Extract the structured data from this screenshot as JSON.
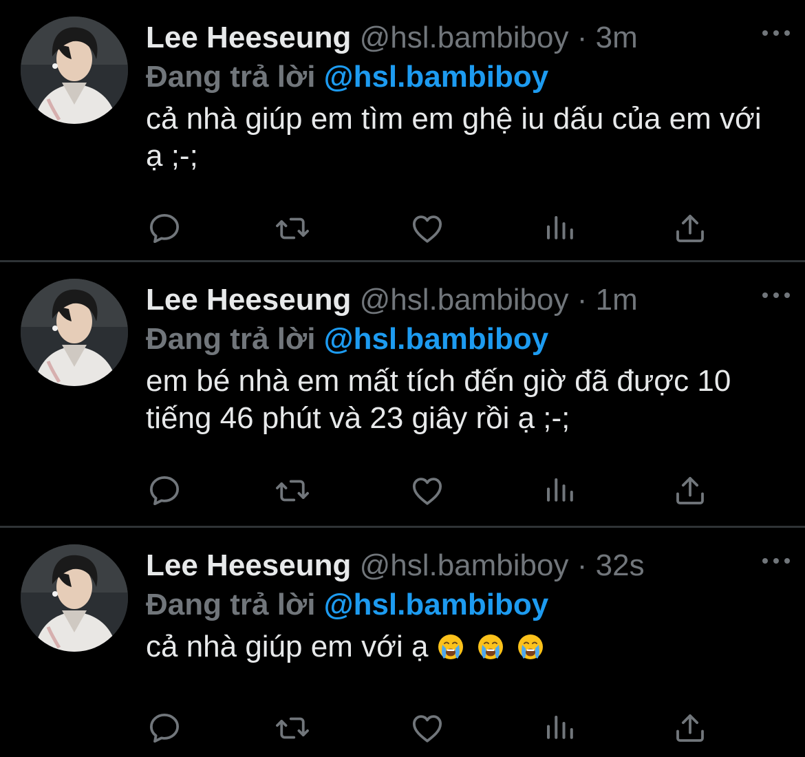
{
  "colors": {
    "background": "#000000",
    "text": "#e7e9ea",
    "muted": "#71767b",
    "link": "#1d9bf0",
    "divider": "#2f3336"
  },
  "tweets": [
    {
      "name": "Lee Heeseung",
      "handle": "@hsl.bambiboy",
      "separator": "·",
      "time": "3m",
      "reply_prefix": "Đang trả lời",
      "reply_to": "@hsl.bambiboy",
      "text": "cả nhà giúp em tìm em ghệ iu dấu của em với ạ ;-;",
      "actions": [
        "reply-icon",
        "retweet-icon",
        "like-icon",
        "views-icon",
        "share-icon"
      ]
    },
    {
      "name": "Lee Heeseung",
      "handle": "@hsl.bambiboy",
      "separator": "·",
      "time": "1m",
      "reply_prefix": "Đang trả lời",
      "reply_to": "@hsl.bambiboy",
      "text": "em bé nhà em mất tích đến giờ đã được 10 tiếng 46 phút và 23 giây rồi ạ ;-;",
      "actions": [
        "reply-icon",
        "retweet-icon",
        "like-icon",
        "views-icon",
        "share-icon"
      ]
    },
    {
      "name": "Lee Heeseung",
      "handle": "@hsl.bambiboy",
      "separator": "·",
      "time": "32s",
      "reply_prefix": "Đang trả lời",
      "reply_to": "@hsl.bambiboy",
      "text": "cả nhà giúp em với ạ",
      "emojis": [
        "loudly-crying-face",
        "loudly-crying-face",
        "loudly-crying-face"
      ],
      "actions": [
        "reply-icon",
        "retweet-icon",
        "like-icon",
        "views-icon",
        "share-icon"
      ]
    }
  ]
}
